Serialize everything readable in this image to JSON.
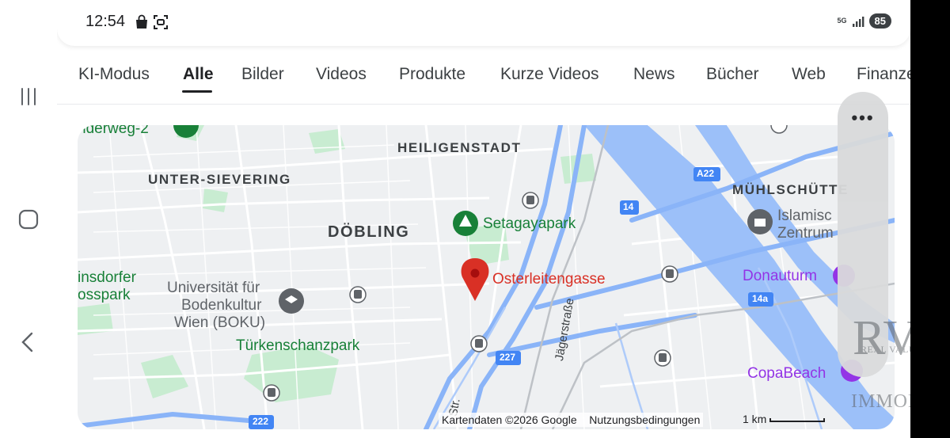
{
  "status_bar": {
    "time": "12:54",
    "battery": "85",
    "network": "5G",
    "icons": [
      "shopping-bag-icon",
      "screenshot-icon",
      "signal-icon"
    ]
  },
  "tabs": [
    {
      "label": "KI-Modus"
    },
    {
      "label": "Alle",
      "active": true
    },
    {
      "label": "Bilder"
    },
    {
      "label": "Videos"
    },
    {
      "label": "Produkte"
    },
    {
      "label": "Kurze Videos"
    },
    {
      "label": "News"
    },
    {
      "label": "Bücher"
    },
    {
      "label": "Web"
    },
    {
      "label": "Finanze"
    }
  ],
  "map": {
    "districts": [
      "HEILIGENSTADT",
      "UNTER-SIEVERING",
      "DÖBLING",
      "MÜHLSCHÜTTE"
    ],
    "places": [
      "Universität für",
      "Bodenkultur",
      "Wien (BOKU)",
      "Islamisc",
      "Zentrum",
      "insdorfer",
      "osspark",
      "nderweg-2"
    ],
    "parks": [
      "Setagayapark",
      "Türkenschanzpark"
    ],
    "pin_label": "Osterleitengasse",
    "purple_pois": [
      "Donauturm",
      "CopaBeach"
    ],
    "streets": [
      "Jägerstraße",
      "Str."
    ],
    "road_shields": [
      "A22",
      "14",
      "14a",
      "227",
      "222"
    ],
    "attribution": "Kartendaten ©2026 Google",
    "terms": "Nutzungsbedingungen",
    "scale": "1 km"
  },
  "overflow_button": "•••",
  "watermark": {
    "letters": "RVC",
    "subtitle": "REAL VALUE CONSULT",
    "bottom": "IMMOBILIEN"
  },
  "colors": {
    "pin": "#d93025",
    "park": "#188038",
    "water": "#9cc0f9",
    "highway": "#8ab4f8",
    "poi_purple": "#9334e6"
  }
}
